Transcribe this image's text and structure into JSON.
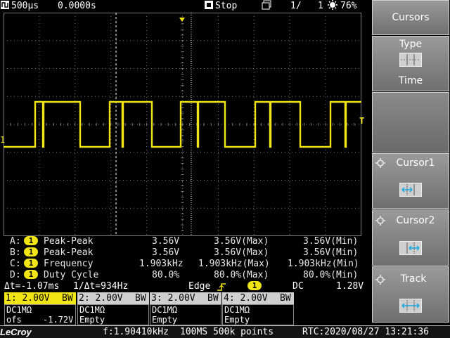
{
  "topbar": {
    "timebase": "500µs",
    "delay": "0.0000s",
    "run_state": "Stop",
    "page": "1/",
    "page_total": "1",
    "battery": "76%"
  },
  "screen": {
    "trigger_marker_left": "1",
    "trigger_level_marker": "T"
  },
  "measurements": [
    {
      "slot": "A:",
      "chan": "1",
      "name": "Peak-Peak",
      "val": "3.56V",
      "max": "3.56V(Max)",
      "min": "3.56V(Min)"
    },
    {
      "slot": "B:",
      "chan": "1",
      "name": "Peak-Peak",
      "val": "3.56V",
      "max": "3.56V(Max)",
      "min": "3.56V(Min)"
    },
    {
      "slot": "C:",
      "chan": "1",
      "name": "Frequency",
      "val": "1.903kHz",
      "max": "1.903kHz(Max)",
      "min": "1.903kHz(Min)"
    },
    {
      "slot": "D:",
      "chan": "1",
      "name": "Duty Cycle",
      "val": "80.0%",
      "max": "80.0%(Max)",
      "min": "80.0%(Min)"
    }
  ],
  "cursor_readout": {
    "delta_t": "Δt=-1.07ms",
    "inv_delta_t": "1/Δt=934Hz",
    "trigger_type": "Edge",
    "trigger_chan": "1",
    "coupling": "DC",
    "trigger_level": "1.28V"
  },
  "channels": [
    {
      "label": "1: 2.00V",
      "bw": "BW",
      "coupling": "DC1MΩ",
      "extra_label": "ofs",
      "extra_val": "-1.72V"
    },
    {
      "label": "2: 2.00V",
      "bw": "BW",
      "coupling": "DC1MΩ",
      "extra_label": "",
      "extra_val": "Empty"
    },
    {
      "label": "3: 2.00V",
      "bw": "BW",
      "coupling": "DC1MΩ",
      "extra_label": "",
      "extra_val": "Empty"
    },
    {
      "label": "4: 2.00V",
      "bw": "BW",
      "coupling": "DC1MΩ",
      "extra_label": "",
      "extra_val": "Empty"
    }
  ],
  "status": {
    "brand": "LeCroy",
    "frequency": "f:1.90410kHz",
    "sample": "100MS 500k points",
    "rtc": "RTC:2020/08/27 13:21:36"
  },
  "menu": {
    "title": "Cursors",
    "type_label": "Type",
    "type_value": "Time",
    "cursor1_label": "Cursor1",
    "cursor2_label": "Cursor2",
    "track_label": "Track"
  },
  "colors": {
    "ch1": "#f2e516",
    "grid": "#7a7a7a",
    "menu": "#888888"
  }
}
